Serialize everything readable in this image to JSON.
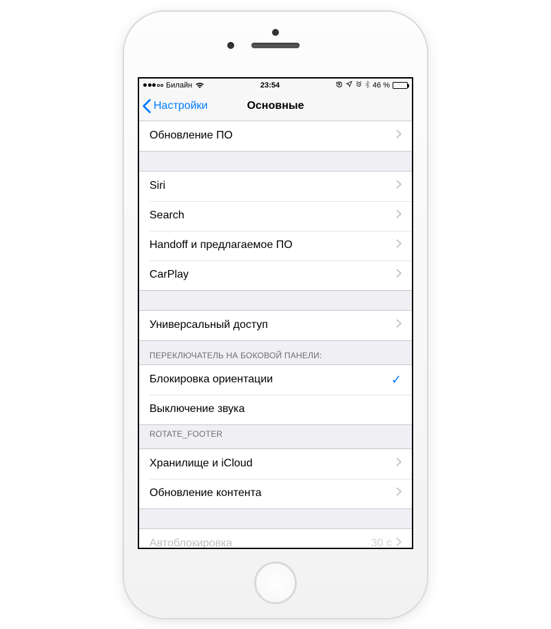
{
  "statusbar": {
    "carrier": "Билайн",
    "time": "23:54",
    "battery_percent": "46 %"
  },
  "nav": {
    "back": "Настройки",
    "title": "Основные"
  },
  "rows": {
    "software_update": "Обновление ПО",
    "siri": "Siri",
    "search": "Search",
    "handoff": "Handoff и предлагаемое ПО",
    "carplay": "CarPlay",
    "accessibility": "Универсальный доступ",
    "side_switch_header": "ПЕРЕКЛЮЧАТЕЛЬ НА БОКОВОЙ ПАНЕЛИ:",
    "lock_rotation": "Блокировка ориентации",
    "mute": "Выключение звука",
    "rotate_footer": "ROTATE_FOOTER",
    "storage": "Хранилище и iCloud",
    "background_refresh": "Обновление контента",
    "autolock": "Автоблокировка",
    "autolock_value": "30 с"
  }
}
